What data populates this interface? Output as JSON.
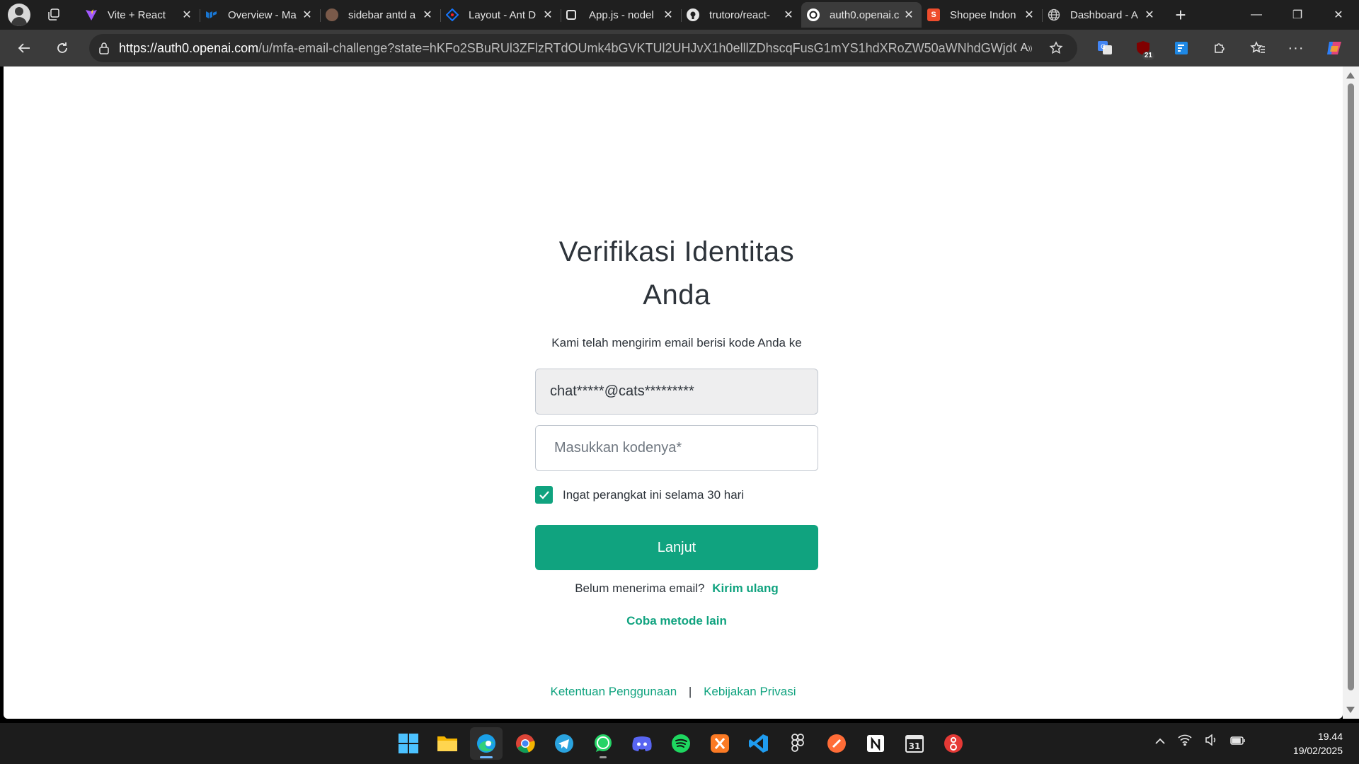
{
  "browser": {
    "tabs": [
      {
        "title": "Vite + React",
        "icon": "vite-icon",
        "color": "#a259ff"
      },
      {
        "title": "Overview - Ma",
        "icon": "mui-icon",
        "color": "#1976d2"
      },
      {
        "title": "sidebar antd a",
        "icon": "avatar-favicon",
        "color": "#7a5a4a"
      },
      {
        "title": "Layout - Ant D",
        "icon": "antd-icon",
        "color": "#1677ff"
      },
      {
        "title": "App.js - nodel",
        "icon": "codesandbox-icon",
        "color": "#ffffff"
      },
      {
        "title": "trutoro/react-",
        "icon": "github-icon",
        "color": "#ffffff"
      },
      {
        "title": "auth0.openai.c",
        "icon": "openai-icon",
        "color": "#ffffff"
      },
      {
        "title": "Shopee Indon",
        "icon": "shopee-icon",
        "color": "#ee4d2d"
      },
      {
        "title": "Dashboard - A",
        "icon": "globe-icon",
        "color": "#cccccc"
      }
    ],
    "active_tab_index": 6,
    "url_host": "https://auth0.openai.com",
    "url_path": "/u/mfa-email-challenge?state=hKFo2SBuRUl3ZFlzRTdOUmk4bGVKTUl2UHJvX1h0elllZDhscqFusG1mYS1hdXRoZW50aWNhdGWjdGl...",
    "extension_badge": "21"
  },
  "page": {
    "title": "Verifikasi Identitas Anda",
    "subtitle": "Kami telah mengirim email berisi kode Anda ke",
    "email": "chat*****@cats*********",
    "code_placeholder": "Masukkan kodenya*",
    "remember_label": "Ingat perangkat ini selama 30 hari",
    "remember_checked": true,
    "continue_label": "Lanjut",
    "resend_prompt": "Belum menerima email?",
    "resend_link": "Kirim ulang",
    "other_method": "Coba metode lain",
    "footer_terms": "Ketentuan Penggunaan",
    "footer_sep": "|",
    "footer_privacy": "Kebijakan Privasi",
    "accent_color": "#10a37f"
  },
  "taskbar": {
    "apps": [
      "windows-start-icon",
      "file-explorer-icon",
      "edge-icon",
      "chrome-icon",
      "telegram-icon",
      "whatsapp-icon",
      "discord-icon",
      "spotify-icon",
      "xampp-icon",
      "vscode-icon",
      "figma-icon",
      "postman-icon",
      "notion-icon",
      "calendar-icon",
      "git-client-icon"
    ],
    "calendar_day": "31",
    "time": "19.44",
    "date": "19/02/2025"
  }
}
